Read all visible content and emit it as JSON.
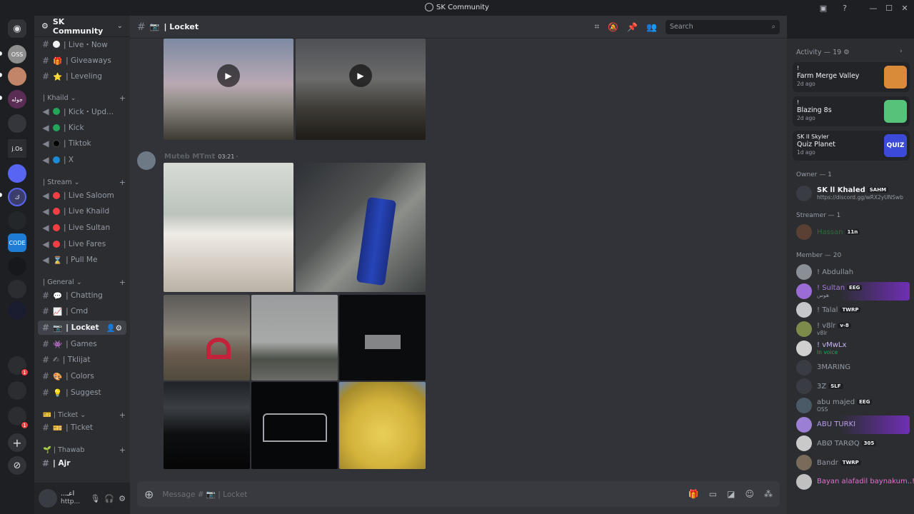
{
  "window": {
    "title": "SK Community"
  },
  "guilds": [
    {
      "label": "OSS",
      "color": "#8e8e8e"
    },
    {
      "label": "",
      "color": "#c2856a"
    },
    {
      "label": "جوله",
      "color": "#5a2d54"
    },
    {
      "label": "",
      "color": "#35363c"
    },
    {
      "label": "j.Os",
      "color": "#2b2d31"
    },
    {
      "label": "",
      "color": "#5865f2"
    },
    {
      "label": "ك",
      "color": "#3b3e6b"
    },
    {
      "label": "",
      "color": "#23272a"
    },
    {
      "label": "CODE",
      "color": "#1e7bd6"
    },
    {
      "label": "",
      "color": "#17181b"
    },
    {
      "label": "",
      "color": "#2b2d31"
    },
    {
      "label": "",
      "color": "#1a1c30"
    },
    {
      "label": "",
      "color": "#2b2d31"
    }
  ],
  "guild_badges": [
    "1",
    "1"
  ],
  "server": {
    "name": "SK Community"
  },
  "channels": {
    "top": [
      {
        "label": "| Live・Now",
        "icon": "white-circle"
      },
      {
        "label": "| Giveaways",
        "icon": "gift"
      },
      {
        "label": "| Leveling",
        "icon": "star"
      }
    ],
    "khaild": {
      "name": "| Khaild",
      "items": [
        {
          "label": "| Kick・Upd...",
          "icon": "green-circle"
        },
        {
          "label": "| Kick",
          "icon": "green-circle"
        },
        {
          "label": "| Tiktok",
          "icon": "black-circle"
        },
        {
          "label": "| X",
          "icon": "blue-circle"
        }
      ]
    },
    "stream": {
      "name": "| Stream",
      "items": [
        {
          "label": "| Live Saloom",
          "icon": "red-circle"
        },
        {
          "label": "| Live Khaild",
          "icon": "red-circle"
        },
        {
          "label": "| Live Sultan",
          "icon": "red-circle"
        },
        {
          "label": "| Live Fares",
          "icon": "red-circle"
        },
        {
          "label": "| Pull Me",
          "icon": "hourglass"
        }
      ]
    },
    "general": {
      "name": "| General",
      "items": [
        {
          "label": "| Chatting",
          "icon": "speech-bubble"
        },
        {
          "label": "| Cmd",
          "icon": "chart"
        },
        {
          "label": "| Locket",
          "icon": "camera"
        },
        {
          "label": "| Games",
          "icon": "invader"
        },
        {
          "label": "| Tklijat",
          "icon": "hand"
        },
        {
          "label": "| Colors",
          "icon": "palette"
        },
        {
          "label": "| Suggest",
          "icon": "bulb"
        }
      ]
    },
    "ticket": {
      "name": "| Ticket",
      "items": [
        {
          "label": "| Ticket",
          "icon": "ticket"
        }
      ]
    },
    "thawab": {
      "name": "| Thawab",
      "items": [
        {
          "label": "| Ajr",
          "icon": ""
        }
      ]
    }
  },
  "user_panel": {
    "name": "...اعـ",
    "status": "http..."
  },
  "chat": {
    "channel_name": "| Locket",
    "channel_emoji": "📷",
    "search_placeholder": "Search",
    "message": {
      "author": "Muteb MTmt",
      "time": "03:21 ·"
    },
    "composer_placeholder": "Message # 📷 | Locket"
  },
  "members": {
    "activity_header": "Activity — 19",
    "activities": [
      {
        "user": "! ",
        "game": "Farm Merge Valley",
        "ago": "2d ago",
        "color": "#d98b3a"
      },
      {
        "user": "! ",
        "game": "Blazing 8s",
        "ago": "2d ago",
        "color": "#56c27a"
      },
      {
        "user": "SK II Skyler",
        "game": "Quiz Planet",
        "ago": "1d ago",
        "color": "#3b4ad9"
      }
    ],
    "owner_header": "Owner — 1",
    "owner": {
      "name": "SK ll Khaled",
      "tag": "SAHM",
      "sub": "https://discord.gg/wRX2yUNSwb"
    },
    "streamer_header": "Streamer — 1",
    "streamer": {
      "name": "Hassan",
      "tag": "11n"
    },
    "member_header": "Member — 20",
    "list": [
      {
        "name": "! Abdullah",
        "tag": "",
        "sub": "",
        "color": "#949ba4"
      },
      {
        "name": "! Sultan",
        "tag": "EEG",
        "sub": "هوس",
        "color": "#a67bd9"
      },
      {
        "name": "! Talal",
        "tag": "TWRP",
        "sub": "",
        "color": "#949ba4"
      },
      {
        "name": "! v8lr",
        "tag": "v-8",
        "sub": "v8lr",
        "color": "#949ba4"
      },
      {
        "name": "! vMwLx",
        "tag": "",
        "sub": "In voice",
        "color": "#c9b6f5"
      },
      {
        "name": "3MARING",
        "tag": "",
        "sub": "",
        "color": "#949ba4"
      },
      {
        "name": "3Z",
        "tag": "SLF",
        "sub": "",
        "color": "#949ba4"
      },
      {
        "name": "abu majed",
        "tag": "EEG",
        "sub": "OSS",
        "color": "#949ba4"
      },
      {
        "name": "ABU TURKI",
        "tag": "",
        "sub": "",
        "color": "#b69de8"
      },
      {
        "name": "ABØ TARØQ",
        "tag": "305",
        "sub": "",
        "color": "#949ba4"
      },
      {
        "name": "Bandr",
        "tag": "TWRP",
        "sub": "",
        "color": "#949ba4"
      },
      {
        "name": "Bayan alafadil baynakum..!",
        "tag": "",
        "sub": "",
        "color": "#e46fd0"
      }
    ]
  }
}
